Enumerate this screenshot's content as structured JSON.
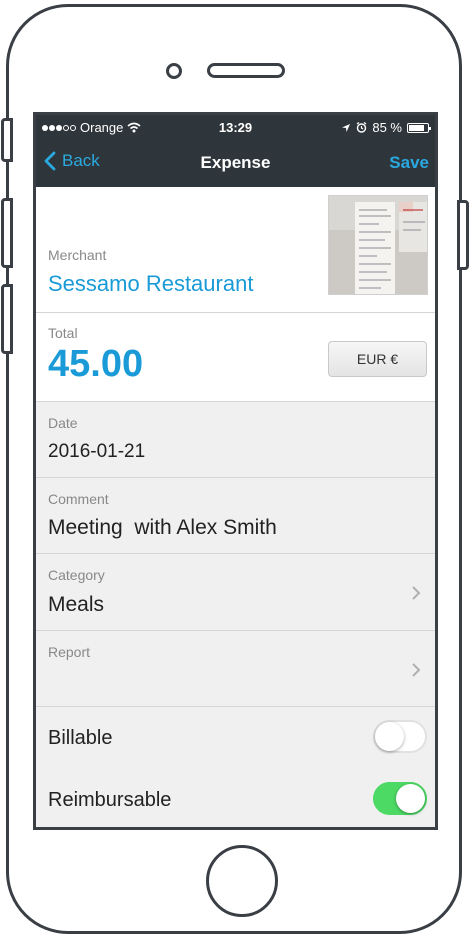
{
  "status_bar": {
    "carrier": "Orange",
    "time": "13:29",
    "battery": "85 %",
    "battery_level": 0.85
  },
  "nav": {
    "back_label": "Back",
    "title": "Expense",
    "save_label": "Save"
  },
  "merchant": {
    "label": "Merchant",
    "value": "Sessamo Restaurant"
  },
  "total": {
    "label": "Total",
    "value": "45.00",
    "currency": "EUR €"
  },
  "date": {
    "label": "Date",
    "value": "2016-01-21"
  },
  "comment": {
    "label": "Comment",
    "value": "Meeting  with Alex Smith"
  },
  "category": {
    "label": "Category",
    "value": "Meals"
  },
  "report": {
    "label": "Report",
    "value": ""
  },
  "toggles": {
    "billable_label": "Billable",
    "billable_on": false,
    "reimbursable_label": "Reimbursable",
    "reimbursable_on": true
  },
  "colors": {
    "accent": "#1a9bd7",
    "header_bg": "#2f363b",
    "toggle_on": "#4cd964"
  }
}
